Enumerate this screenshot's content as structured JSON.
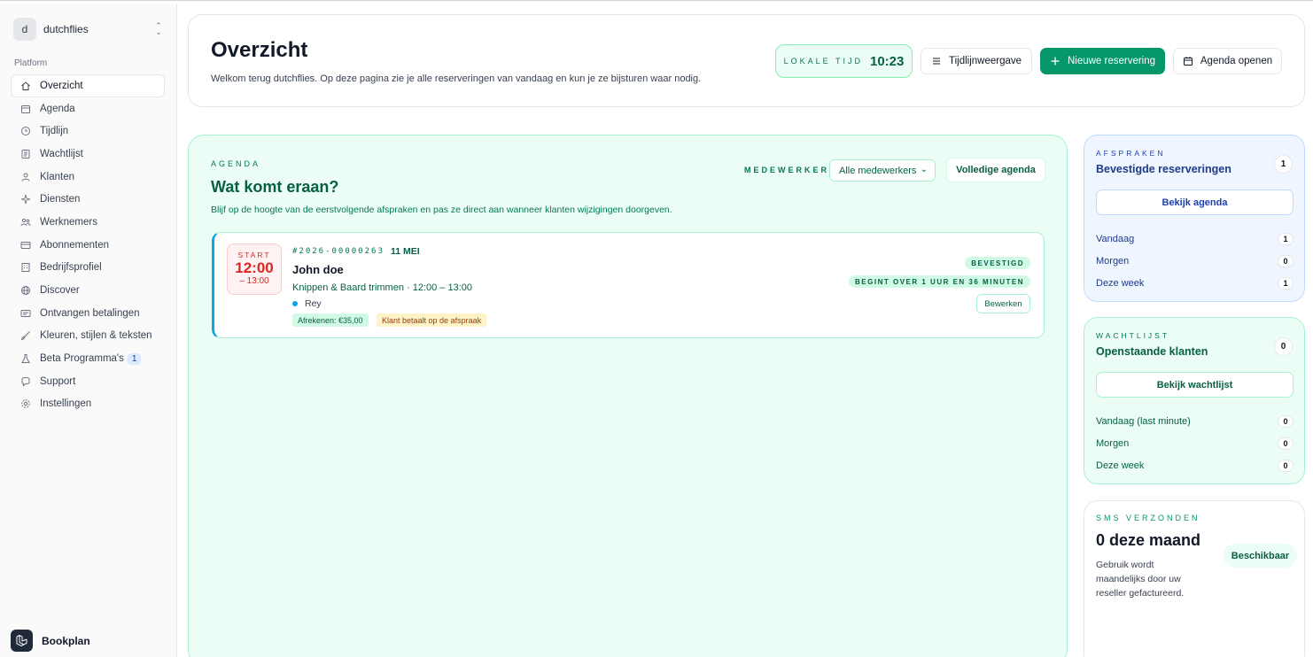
{
  "sidebar": {
    "team": {
      "initial": "d",
      "name": "dutchflies"
    },
    "section_label": "Platform",
    "items": [
      {
        "label": "Overzicht",
        "icon": "home-icon",
        "active": true
      },
      {
        "label": "Agenda",
        "icon": "calendar-icon"
      },
      {
        "label": "Tijdlijn",
        "icon": "clock-icon"
      },
      {
        "label": "Wachtlijst",
        "icon": "list-icon"
      },
      {
        "label": "Klanten",
        "icon": "users-icon"
      },
      {
        "label": "Diensten",
        "icon": "sparkles-icon"
      },
      {
        "label": "Werknemers",
        "icon": "team-icon"
      },
      {
        "label": "Abonnementen",
        "icon": "credit-card-icon"
      },
      {
        "label": "Bedrijfsprofiel",
        "icon": "building-icon"
      },
      {
        "label": "Discover",
        "icon": "globe-icon"
      },
      {
        "label": "Ontvangen betalingen",
        "icon": "payments-icon"
      },
      {
        "label": "Kleuren, stijlen & teksten",
        "icon": "brush-icon"
      },
      {
        "label": "Beta Programma's",
        "icon": "flask-icon",
        "badge": "1"
      },
      {
        "label": "Support",
        "icon": "chat-icon"
      },
      {
        "label": "Instellingen",
        "icon": "gear-icon"
      }
    ],
    "brand": "Bookplan"
  },
  "header": {
    "title": "Overzicht",
    "subtitle": "Welkom terug dutchflies. Op deze pagina zie je alle reserveringen van vandaag en kun je ze bijsturen waar nodig.",
    "clock_label": "LOKALE TIJD",
    "clock_time": "10:23",
    "btn_timeline": "Tijdlijnweergave",
    "btn_new": "Nieuwe reservering",
    "btn_agenda": "Agenda openen"
  },
  "agenda": {
    "eyebrow": "AGENDA",
    "title": "Wat komt eraan?",
    "subtitle": "Blijf op de hoogte van de eerstvolgende afspraken en pas ze direct aan wanneer klanten wijzigingen doorgeven.",
    "employee_label": "MEDEWERKER",
    "employee_selected": "Alle medewerkers",
    "btn_full": "Volledige agenda",
    "appointment": {
      "start_label": "START",
      "start_time": "12:00",
      "end_time": "– 13:00",
      "id": "#2026-00000263",
      "date": "11 MEI",
      "name": "John doe",
      "service": "Knippen & Baard trimmen · 12:00 – 13:00",
      "employee": "Rey",
      "tag_pay": "Afrekenen: €35,00",
      "tag_note": "Klant betaalt op de afspraak",
      "status": "BEVESTIGD",
      "begins": "BEGINT OVER 1 UUR EN 36 MINUTEN",
      "btn_edit": "Bewerken"
    }
  },
  "cards": {
    "afspraken": {
      "eyebrow": "AFSPRAKEN",
      "title": "Bevestigde reserveringen",
      "count": "1",
      "button": "Bekijk agenda",
      "stats": [
        {
          "label": "Vandaag",
          "value": "1"
        },
        {
          "label": "Morgen",
          "value": "0"
        },
        {
          "label": "Deze week",
          "value": "1"
        }
      ]
    },
    "wachtlijst": {
      "eyebrow": "WACHTLIJST",
      "title": "Openstaande klanten",
      "count": "0",
      "button": "Bekijk wachtlijst",
      "stats": [
        {
          "label": "Vandaag (last minute)",
          "value": "0"
        },
        {
          "label": "Morgen",
          "value": "0"
        },
        {
          "label": "Deze week",
          "value": "0"
        }
      ]
    },
    "sms": {
      "eyebrow": "SMS VERZONDEN",
      "big": "0 deze maand",
      "sub": "Gebruik wordt maandelijks door uw reseller gefactureerd.",
      "badge": "Beschikbaar"
    }
  }
}
